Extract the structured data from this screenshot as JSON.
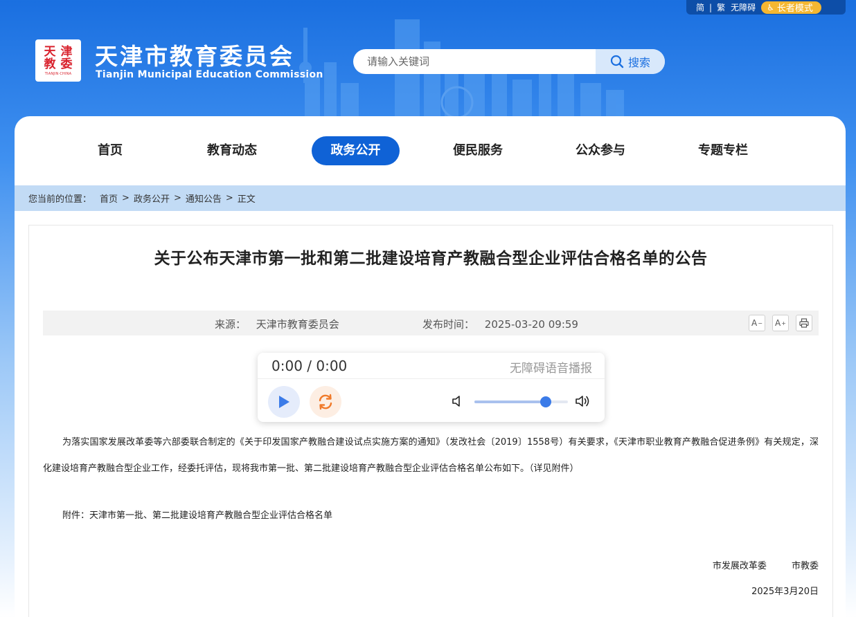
{
  "util_bar": {
    "simplified": "简",
    "divider": "|",
    "traditional": "繁",
    "accessibility": "无障碍",
    "elder_mode": "长者模式"
  },
  "header": {
    "logo_chars": [
      "天",
      "津",
      "教",
      "委"
    ],
    "logo_sub": "TIANJIN·CHINA",
    "title": "天津市教育委员会",
    "subtitle": "Tianjin Municipal Education Commission"
  },
  "search": {
    "placeholder": "请输入关键词",
    "button_label": "搜索"
  },
  "nav": {
    "items": [
      {
        "label": "首页",
        "active": false
      },
      {
        "label": "教育动态",
        "active": false
      },
      {
        "label": "政务公开",
        "active": true
      },
      {
        "label": "便民服务",
        "active": false
      },
      {
        "label": "公众参与",
        "active": false
      },
      {
        "label": "专题专栏",
        "active": false
      }
    ]
  },
  "breadcrumb": {
    "label": "您当前的位置：",
    "items": [
      "首页",
      "政务公开",
      "通知公告",
      "正文"
    ],
    "separator": ">"
  },
  "article": {
    "title": "关于公布天津市第一批和第二批建设培育产教融合型企业评估合格名单的公告",
    "source_label": "来源：",
    "source": "天津市教育委员会",
    "time_label": "发布时间：",
    "time": "2025-03-20 09:59",
    "tools": {
      "font_smaller": "A",
      "font_larger": "A",
      "font_smaller_sup": "−",
      "font_larger_sup": "+"
    },
    "body": "为落实国家发展改革委等六部委联合制定的《关于印发国家产教融合建设试点实施方案的通知》（发改社会〔2019〕1558号）有关要求，《天津市职业教育产教融合促进条例》有关规定，深化建设培育产教融合型企业工作，经委托评估，现将我市第一批、第二批建设培育产教融合型企业评估合格名单公布如下。（详见附件）",
    "attachment": "附件：天津市第一批、第二批建设培育产教融合型企业评估合格名单",
    "signers": [
      "市发展改革委",
      "市教委"
    ],
    "date": "2025年3月20日"
  },
  "player": {
    "time": "0:00 / 0:00",
    "label": "无障碍语音播报",
    "volume": 0.76
  },
  "colors": {
    "primary": "#0f62d6",
    "header_bg": "#1a6fe0",
    "breadcrumb_bg": "#c2dbf5",
    "elder_badge": "#f5b731",
    "play_icon": "#3b7be8",
    "loop_icon": "#f07a2a"
  }
}
